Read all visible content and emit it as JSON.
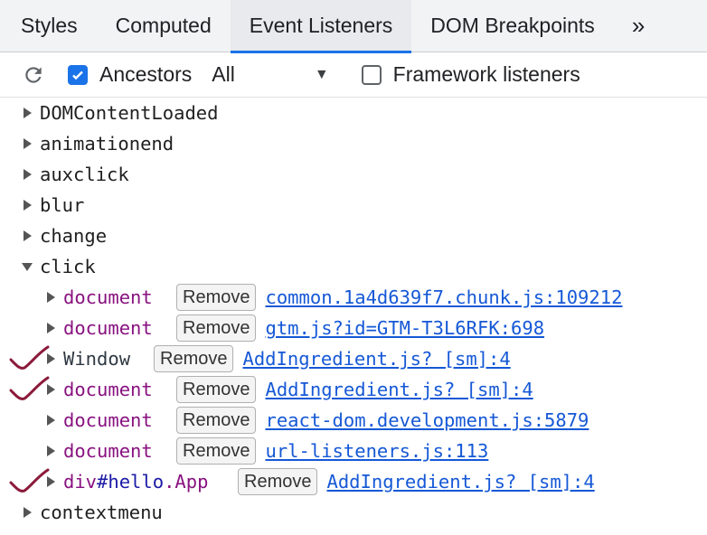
{
  "tabs": [
    {
      "label": "Styles"
    },
    {
      "label": "Computed"
    },
    {
      "label": "Event Listeners"
    },
    {
      "label": "DOM Breakpoints"
    }
  ],
  "tab_more": "»",
  "toolbar": {
    "ancestors_label": "Ancestors",
    "ancestors_checked": true,
    "filter_value": "All",
    "framework_label": "Framework listeners",
    "framework_checked": false
  },
  "events_before": [
    {
      "name": "DOMContentLoaded"
    },
    {
      "name": "animationend"
    },
    {
      "name": "auxclick"
    },
    {
      "name": "blur"
    },
    {
      "name": "change"
    }
  ],
  "expanded_event": {
    "name": "click"
  },
  "listeners": [
    {
      "node": "document",
      "remove": "Remove",
      "source": "common.1a4d639f7.chunk.js:109212",
      "checkmark": false
    },
    {
      "node": "document",
      "remove": "Remove",
      "source": "gtm.js?id=GTM-T3L6RFK:698",
      "checkmark": false
    },
    {
      "node": "Window",
      "remove": "Remove",
      "source": "AddIngredient.js? [sm]:4",
      "checkmark": true
    },
    {
      "node": "document",
      "remove": "Remove",
      "source": "AddIngredient.js? [sm]:4",
      "checkmark": true
    },
    {
      "node": "document",
      "remove": "Remove",
      "source": "react-dom.development.js:5879",
      "checkmark": false
    },
    {
      "node": "document",
      "remove": "Remove",
      "source": "url-listeners.js:113",
      "checkmark": false
    },
    {
      "node_tag": "div",
      "node_id": "#hello",
      "node_class": ".App",
      "remove": "Remove",
      "source": "AddIngredient.js? [sm]:4",
      "checkmark": true
    }
  ],
  "events_after": [
    {
      "name": "contextmenu"
    }
  ],
  "colors": {
    "accent": "#1a73e8",
    "link": "#1558d6",
    "node": "#881280",
    "checkmark": "#8b1a3a"
  }
}
